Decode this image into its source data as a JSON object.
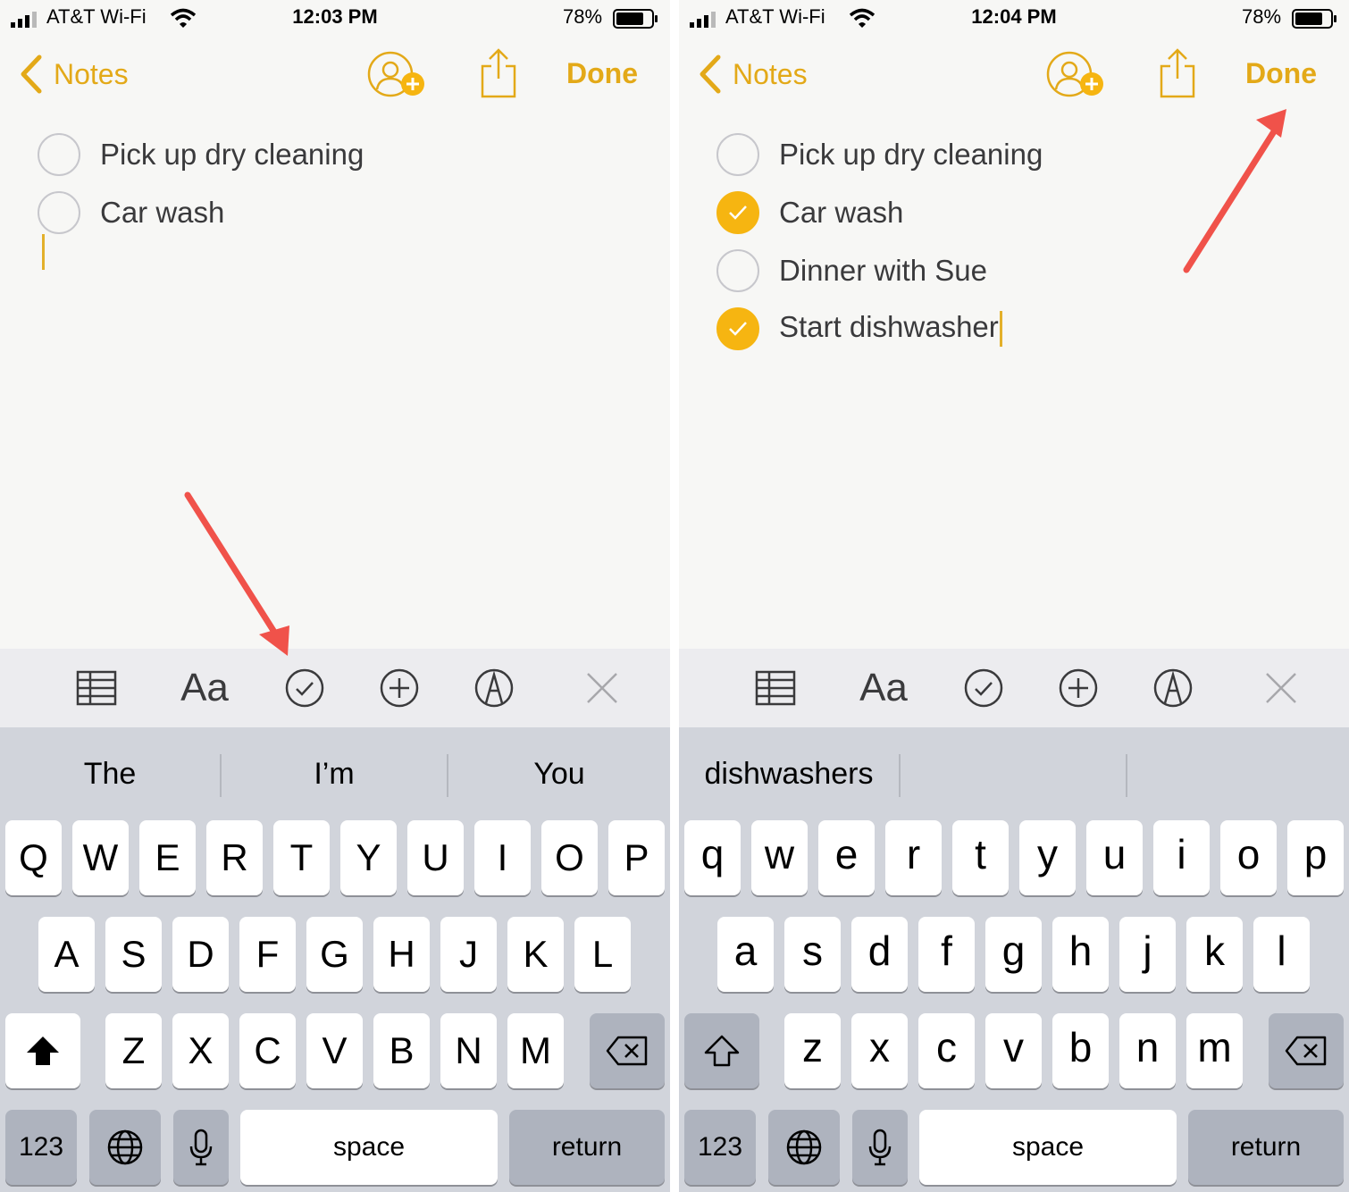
{
  "accent_color": "#e3a918",
  "check_color": "#f6b511",
  "annotation_color": "#f0524a",
  "left": {
    "status": {
      "carrier": "AT&T Wi-Fi",
      "time": "12:03 PM",
      "battery": "78%"
    },
    "nav": {
      "back_label": "Notes",
      "done_label": "Done"
    },
    "items": [
      {
        "text": "Pick up dry cleaning",
        "checked": false
      },
      {
        "text": "Car wash",
        "checked": false
      }
    ],
    "suggestions": [
      "The",
      "I’m",
      "You"
    ],
    "keys": {
      "row1": [
        "Q",
        "W",
        "E",
        "R",
        "T",
        "Y",
        "U",
        "I",
        "O",
        "P"
      ],
      "row2": [
        "A",
        "S",
        "D",
        "F",
        "G",
        "H",
        "J",
        "K",
        "L"
      ],
      "row3": [
        "Z",
        "X",
        "C",
        "V",
        "B",
        "N",
        "M"
      ],
      "numbers": "123",
      "space": "space",
      "return": "return"
    }
  },
  "right": {
    "status": {
      "carrier": "AT&T Wi-Fi",
      "time": "12:04 PM",
      "battery": "78%"
    },
    "nav": {
      "back_label": "Notes",
      "done_label": "Done"
    },
    "items": [
      {
        "text": "Pick up dry cleaning",
        "checked": false
      },
      {
        "text": "Car wash",
        "checked": true
      },
      {
        "text": "Dinner with Sue",
        "checked": false
      },
      {
        "text": "Start dishwasher",
        "checked": true
      }
    ],
    "suggestions": [
      "dishwashers",
      "",
      ""
    ],
    "keys": {
      "row1": [
        "q",
        "w",
        "e",
        "r",
        "t",
        "y",
        "u",
        "i",
        "o",
        "p"
      ],
      "row2": [
        "a",
        "s",
        "d",
        "f",
        "g",
        "h",
        "j",
        "k",
        "l"
      ],
      "row3": [
        "z",
        "x",
        "c",
        "v",
        "b",
        "n",
        "m"
      ],
      "numbers": "123",
      "space": "space",
      "return": "return"
    }
  },
  "icons": {
    "toolbar": [
      "table-icon",
      "text-format-icon",
      "checklist-icon",
      "add-icon",
      "markup-icon",
      "close-icon"
    ],
    "nav": [
      "back-chevron-icon",
      "add-person-icon",
      "share-icon"
    ],
    "keyboard": [
      "shift-icon",
      "delete-icon",
      "globe-icon",
      "microphone-icon"
    ]
  }
}
